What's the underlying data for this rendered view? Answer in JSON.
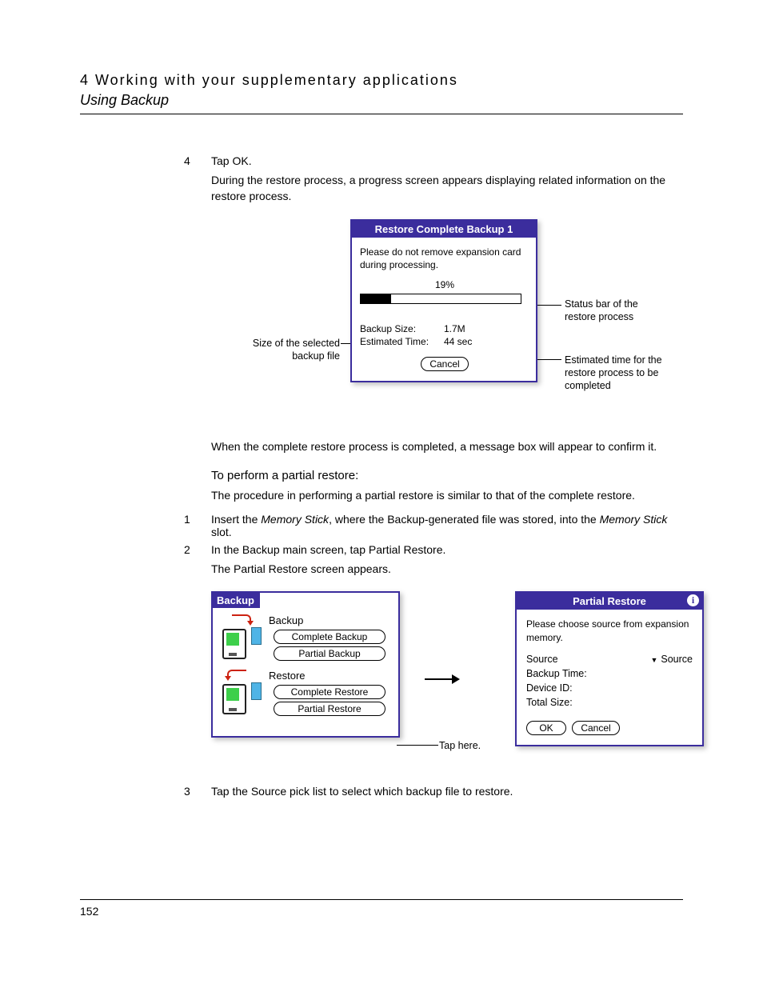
{
  "header": {
    "chapter": "4 Working with your supplementary applications",
    "section": "Using Backup"
  },
  "steps": {
    "s4_num": "4",
    "s4_text": "Tap OK.",
    "s4_para": "During the restore process, a progress screen appears displaying related information on the restore process.",
    "s4_after": "When the complete restore process is completed, a message box will appear to confirm it.",
    "subhead": "To perform a partial restore:",
    "sub_para": "The procedure in performing a partial restore is similar to that of the complete restore.",
    "s1_num": "1",
    "s1_text_a": "Insert the ",
    "s1_term1": "Memory Stick",
    "s1_text_b": ", where the Backup-generated file was stored, into the ",
    "s1_term2": "Memory Stick",
    "s1_text_c": " slot.",
    "s2_num": "2",
    "s2_text": "In the Backup main screen, tap Partial Restore.",
    "s2_para": "The Partial Restore screen appears.",
    "s3_num": "3",
    "s3_text": "Tap the Source pick list to select which backup file to restore."
  },
  "restore_progress": {
    "title": "Restore Complete Backup 1",
    "msg": "Please do not remove expansion card during processing.",
    "percent_label": "19%",
    "percent_value": 19,
    "size_label": "Backup Size:",
    "size_value": "1.7M",
    "time_label": "Estimated Time:",
    "time_value": "44 sec",
    "cancel": "Cancel"
  },
  "callouts": {
    "left1": "Size of the selected backup file",
    "right1": "Status bar of the restore process",
    "right2": "Estimated time for the restore process to be completed"
  },
  "backup_screen": {
    "title": "Backup",
    "group1": "Backup",
    "btn1": "Complete Backup",
    "btn2": "Partial Backup",
    "group2": "Restore",
    "btn3": "Complete Restore",
    "btn4": "Partial Restore"
  },
  "tap_here": "Tap here.",
  "partial_restore": {
    "title": "Partial Restore",
    "info_glyph": "i",
    "msg": "Please choose source from expansion memory.",
    "source_label": "Source",
    "source_value": "Source",
    "backup_time": "Backup Time:",
    "device_id": "Device ID:",
    "total_size": "Total Size:",
    "ok": "OK",
    "cancel": "Cancel"
  },
  "footer": {
    "page": "152"
  }
}
